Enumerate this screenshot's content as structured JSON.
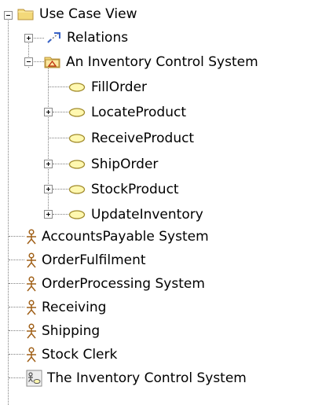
{
  "tree": {
    "root": {
      "label": "Use Case View",
      "icon": "folder-icon",
      "expanded": true
    },
    "relations": {
      "label": "Relations",
      "icon": "relations-icon",
      "expanded": false
    },
    "package": {
      "label": "An Inventory Control System",
      "icon": "package-icon",
      "expanded": true
    },
    "use_cases": [
      {
        "label": "FillOrder",
        "icon": "use-case-icon",
        "has_children": false
      },
      {
        "label": "LocateProduct",
        "icon": "use-case-icon",
        "has_children": true
      },
      {
        "label": "ReceiveProduct",
        "icon": "use-case-icon",
        "has_children": false
      },
      {
        "label": "ShipOrder",
        "icon": "use-case-icon",
        "has_children": true
      },
      {
        "label": "StockProduct",
        "icon": "use-case-icon",
        "has_children": true
      },
      {
        "label": "UpdateInventory",
        "icon": "use-case-icon",
        "has_children": true
      }
    ],
    "actors": [
      {
        "label": "AccountsPayable System",
        "icon": "actor-icon"
      },
      {
        "label": "OrderFulfilment",
        "icon": "actor-icon"
      },
      {
        "label": "OrderProcessing System",
        "icon": "actor-icon"
      },
      {
        "label": "Receiving",
        "icon": "actor-icon"
      },
      {
        "label": "Shipping",
        "icon": "actor-icon"
      },
      {
        "label": "Stock Clerk",
        "icon": "actor-icon"
      }
    ],
    "diagram": {
      "label": "The Inventory Control System",
      "icon": "diagram-icon"
    }
  },
  "colors": {
    "folder": "#f3d97a",
    "use_case_fill": "#fff8b0",
    "use_case_stroke": "#a08a2a",
    "actor": "#a06018",
    "relations": "#3a64c8"
  }
}
